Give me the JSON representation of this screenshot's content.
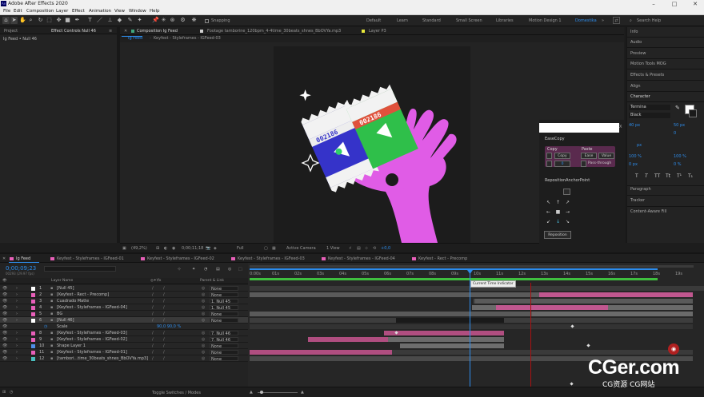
{
  "window": {
    "title": "Adobe After Effects 2020",
    "app_badge": "Ae"
  },
  "menu": [
    "File",
    "Edit",
    "Composition",
    "Layer",
    "Effect",
    "Animation",
    "View",
    "Window",
    "Help"
  ],
  "toolbar": {
    "snapping_label": "Snapping",
    "workspaces": [
      "Default",
      "Learn",
      "Standard",
      "Small Screen",
      "Libraries",
      "Motion Design 1",
      "Domestika"
    ],
    "active_workspace": "Domestika",
    "search_placeholder": "Search Help"
  },
  "left_panel": {
    "tabs": [
      "Project",
      "Effect Controls Null 46"
    ],
    "subtitle": "Ig Feed • Null 46"
  },
  "viewer": {
    "tabs": [
      {
        "label": "Composition Ig Feed"
      },
      {
        "label": "Footage tamborine_120bpm_4-4time_30beats_shnes_BbOVYa.mp3"
      },
      {
        "label": "Layer P3"
      }
    ],
    "breadcrumbs": [
      "Ig Feed",
      "Keyfest - Styleframes - IGFeed-03"
    ],
    "controls": {
      "zoom": "(49,2%)",
      "timecode": "0;00;11;18",
      "resolution": "Full",
      "camera": "Active Camera",
      "view": "1 View",
      "exposure": "+0,0"
    }
  },
  "artwork": {
    "pack1": {
      "text": "002186"
    },
    "pack2": {
      "text": "002186"
    }
  },
  "scripts_panel": {
    "easecopy_title": "EaseCopy",
    "copy_header": "Copy",
    "copy_button": "Copy",
    "copy_value": "0",
    "paste_header": "Paste",
    "ease_button": "Ease",
    "value_button": "Value",
    "pass_through": "Pass-through",
    "reposition_title": "RepositionAnchorPoint",
    "reposition_button": "Reposition",
    "ticker": "X"
  },
  "right_panel": {
    "items": [
      "Info",
      "Audio",
      "Preview",
      "Motion Tools MOG",
      "Effects & Presets",
      "Align",
      "Character"
    ],
    "character": {
      "font": "Termina",
      "style": "Black",
      "size": "40 px",
      "leading": "50 px",
      "tracking": "0",
      "unit": "px",
      "vscale": "100 %",
      "hscale": "100 %",
      "baseline": "0 px",
      "tsume": "0 %"
    },
    "typo_buttons": [
      "T",
      "T",
      "TT",
      "Tt",
      "T¹",
      "T₁"
    ],
    "lower_items": [
      "Paragraph",
      "Tracker",
      "Content-Aware Fill"
    ]
  },
  "timeline": {
    "tabs": [
      {
        "label": "Ig Feed",
        "color": "#e85fb9",
        "active": true
      },
      {
        "label": "Keyfest - Styleframes - IGFeed-01",
        "color": "#e85fb9"
      },
      {
        "label": "Keyfest - Styleframes - IGFeed-02",
        "color": "#e85fb9"
      },
      {
        "label": "Keyfest - Styleframes - IGFeed-03",
        "color": "#e85fb9"
      },
      {
        "label": "Keyfest - Styleframes - IGFeed-04",
        "color": "#e85fb9"
      },
      {
        "label": "Keyfest - Rect - Precomp",
        "color": "#e85fb9"
      }
    ],
    "current_time": "0;00;09;23",
    "frame_info": "00293 (29.97 fps)",
    "columns": {
      "layer_name": "Layer Name",
      "parent": "Parent & Link"
    },
    "layers": [
      {
        "num": "1",
        "name": "[Null 45]",
        "parent": "None",
        "color": "#ffffff"
      },
      {
        "num": "2",
        "name": "[Keyfest - Rect - Precomp]",
        "parent": "None",
        "color": "#e85fb9"
      },
      {
        "num": "3",
        "name": "Cuadrado Matte",
        "parent": "1. Null 45",
        "color": "#e85fb9"
      },
      {
        "num": "4",
        "name": "[Keyfest - Styleframes - IGFeed-04]",
        "parent": "1. Null 45",
        "color": "#e85fb9"
      },
      {
        "num": "5",
        "name": "BG",
        "parent": "None",
        "color": "#e85fb9"
      },
      {
        "num": "6",
        "name": "[Null 46]",
        "parent": "None",
        "color": "#ffffff",
        "selected": true
      },
      {
        "num": "",
        "name": "Scale",
        "parent": "",
        "value": "90,0 90,0 %",
        "property": true
      },
      {
        "num": "8",
        "name": "[Keyfest - Styleframes - IGFeed-03]",
        "parent": "7. Null 46",
        "color": "#e85fb9"
      },
      {
        "num": "9",
        "name": "[Keyfest - Styleframes - IGFeed-02]",
        "parent": "7. Null 46",
        "color": "#e85fb9"
      },
      {
        "num": "10",
        "name": "Shape Layer 1",
        "parent": "None",
        "color": "#4f8fe8"
      },
      {
        "num": "11",
        "name": "[Keyfest - Styleframes - IGFeed-01]",
        "parent": "None",
        "color": "#e85fb9"
      },
      {
        "num": "12",
        "name": "[tambori...time_30beats_shnes_BbOVYa.mp3]",
        "parent": "None",
        "color": "#4abfbf"
      }
    ],
    "ruler": [
      "0:00s",
      "01s",
      "02s",
      "03s",
      "04s",
      "05s",
      "06s",
      "07s",
      "08s",
      "09s",
      "10s",
      "11s",
      "12s",
      "13s",
      "14s",
      "15s",
      "16s",
      "17s",
      "18s",
      "19s"
    ],
    "tooltip": "Current Time Indicator",
    "footer": "Toggle Switches / Modes"
  },
  "watermark": {
    "brand": "CGer.com",
    "sub": "CG资源 CG网站"
  }
}
